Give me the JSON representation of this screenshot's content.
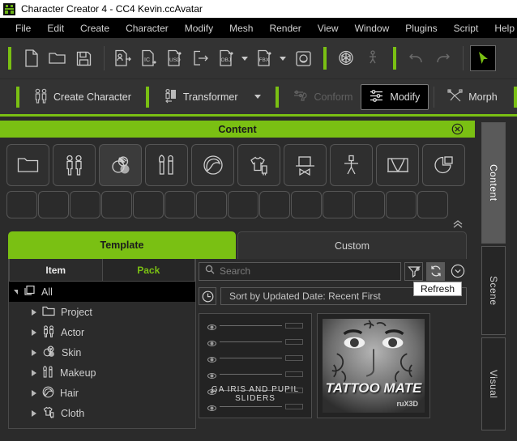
{
  "window": {
    "title": "Character Creator 4 - CC4 Kevin.ccAvatar",
    "logo_icon": "character-creator-logo-icon",
    "accent_color": "#7ac013",
    "chrome_color": "#333333"
  },
  "menubar": {
    "items": [
      {
        "label": "File"
      },
      {
        "label": "Edit"
      },
      {
        "label": "Create"
      },
      {
        "label": "Character"
      },
      {
        "label": "Modify"
      },
      {
        "label": "Mesh"
      },
      {
        "label": "Render"
      },
      {
        "label": "View"
      },
      {
        "label": "Window"
      },
      {
        "label": "Plugins"
      },
      {
        "label": "Script"
      },
      {
        "label": "Help"
      }
    ]
  },
  "toolbar": {
    "buttons": [
      {
        "icon": "new-file-icon",
        "label": "New",
        "enabled": true
      },
      {
        "icon": "open-folder-icon",
        "label": "Open",
        "enabled": true
      },
      {
        "icon": "save-icon",
        "label": "Save",
        "enabled": true
      },
      {
        "icon": "import-character-icon",
        "label": "Import Character",
        "enabled": true
      },
      {
        "icon": "import-ic-icon",
        "label": "Import iClone",
        "enabled": true
      },
      {
        "icon": "import-usd-icon",
        "label": "Import USD",
        "enabled": true
      },
      {
        "icon": "export-icon",
        "label": "Export",
        "enabled": true
      },
      {
        "icon": "export-obj-icon",
        "label": "Export OBJ",
        "enabled": true,
        "dropdown": true
      },
      {
        "icon": "export-fbx-icon",
        "label": "Export FBX",
        "enabled": true,
        "dropdown": true
      },
      {
        "icon": "preview-render-icon",
        "label": "Render",
        "enabled": true
      },
      {
        "icon": "transform-3d-icon",
        "label": "3D Transform",
        "enabled": true
      },
      {
        "icon": "motion-icon",
        "label": "Motion",
        "enabled": false
      },
      {
        "icon": "undo-icon",
        "label": "Undo",
        "enabled": false
      },
      {
        "icon": "redo-icon",
        "label": "Redo",
        "enabled": false
      },
      {
        "icon": "select-cursor-icon",
        "label": "Select",
        "enabled": true,
        "active": true
      }
    ]
  },
  "modebar": {
    "modes": [
      {
        "label": "Create Character",
        "icon": "create-character-icon",
        "state": "normal"
      },
      {
        "label": "Transformer",
        "icon": "transformer-icon",
        "state": "normal",
        "dropdown": true
      },
      {
        "label": "Conform",
        "icon": "conform-icon",
        "state": "disabled"
      },
      {
        "label": "Modify",
        "icon": "modify-icon",
        "state": "active"
      },
      {
        "label": "Morph",
        "icon": "morph-icon",
        "state": "normal"
      }
    ],
    "end_icon": "sphere-shade-icon"
  },
  "content_panel": {
    "title": "Content",
    "close_icon": "close-icon",
    "collapse_icon": "collapse-chevron-icon",
    "categories": [
      {
        "icon": "project-folder-icon",
        "name": "Project"
      },
      {
        "icon": "actor-icon",
        "name": "Actor"
      },
      {
        "icon": "skin-icon",
        "name": "Skin",
        "selected": true
      },
      {
        "icon": "makeup-icon",
        "name": "Makeup"
      },
      {
        "icon": "hair-icon",
        "name": "Hair"
      },
      {
        "icon": "cloth-icon",
        "name": "Cloth"
      },
      {
        "icon": "accessory-icon",
        "name": "Accessory"
      },
      {
        "icon": "motion-pose-icon",
        "name": "Motion"
      },
      {
        "icon": "stage-icon",
        "name": "Stage"
      },
      {
        "icon": "preset-icon",
        "name": "Preset"
      }
    ],
    "favorite_slots_count": 14,
    "tabs": [
      {
        "label": "Template",
        "active": true
      },
      {
        "label": "Custom",
        "active": false
      }
    ],
    "item_pack_tabs": [
      {
        "label": "Item",
        "active": true
      },
      {
        "label": "Pack",
        "active": false
      }
    ],
    "search": {
      "placeholder": "Search",
      "value": "",
      "icon": "search-icon"
    },
    "search_buttons": [
      {
        "icon": "filter-icon",
        "label": "Filter",
        "state": "normal"
      },
      {
        "icon": "refresh-icon",
        "label": "Refresh",
        "state": "hovered"
      },
      {
        "icon": "chevron-down-circle-icon",
        "label": "More",
        "state": "normal"
      }
    ],
    "tooltip": "Refresh",
    "sort": {
      "icon": "clock-icon",
      "label": "Sort by Updated Date: Recent First"
    },
    "tree": [
      {
        "label": "All",
        "icon": "all-items-icon",
        "level": 0,
        "expanded": true,
        "selected": true
      },
      {
        "label": "Project",
        "icon": "project-folder-icon",
        "level": 1,
        "expanded": false,
        "selected": false
      },
      {
        "label": "Actor",
        "icon": "actor-icon",
        "level": 1,
        "expanded": false,
        "selected": false
      },
      {
        "label": "Skin",
        "icon": "skin-icon",
        "level": 1,
        "expanded": false,
        "selected": false
      },
      {
        "label": "Makeup",
        "icon": "makeup-icon",
        "level": 1,
        "expanded": false,
        "selected": false
      },
      {
        "label": "Hair",
        "icon": "hair-icon",
        "level": 1,
        "expanded": false,
        "selected": false
      },
      {
        "label": "Cloth",
        "icon": "cloth-icon",
        "level": 1,
        "expanded": false,
        "selected": false
      }
    ],
    "thumbnails": [
      {
        "title": "GA IRIS AND PUPIL SLIDERS",
        "type": "slider-card",
        "slider_count": 6
      },
      {
        "title": "TATTOO MATE",
        "subtitle": "ruX3D",
        "type": "image-card"
      }
    ]
  },
  "dock": {
    "tabs": [
      {
        "label": "Content",
        "active": true
      },
      {
        "label": "Scene",
        "active": false
      },
      {
        "label": "Visual",
        "active": false
      }
    ]
  }
}
